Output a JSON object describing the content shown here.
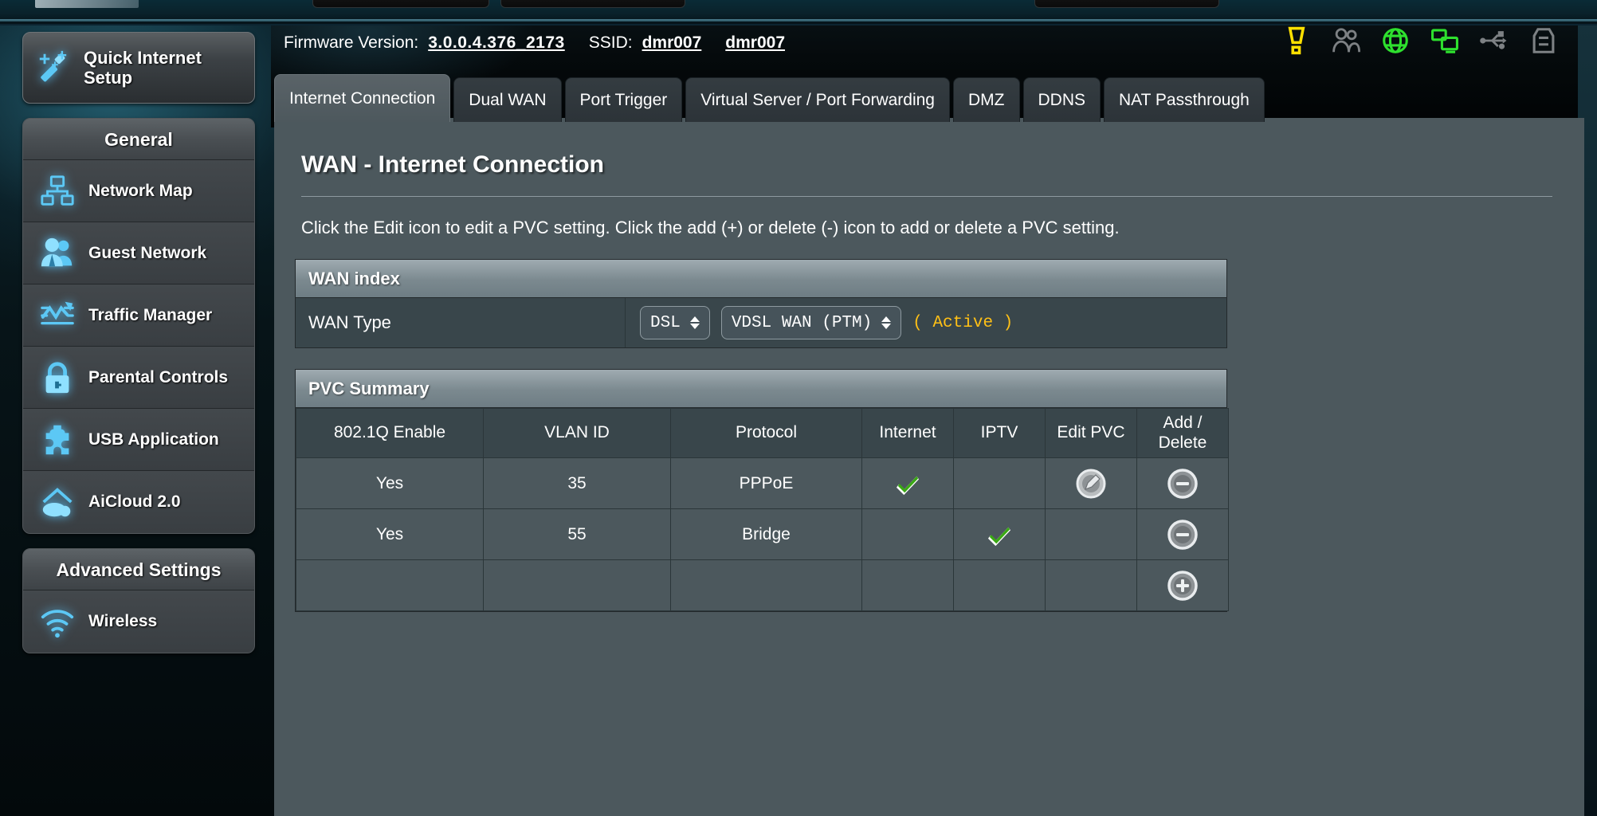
{
  "header": {
    "firmware_label": "Firmware Version:",
    "firmware_value": "3.0.0.4.376_2173",
    "ssid_label": "SSID:",
    "ssid_1": "dmr007",
    "ssid_2": "dmr007",
    "status_icons": [
      {
        "name": "alert-icon",
        "color": "#ffe000"
      },
      {
        "name": "guest-network-icon",
        "color": "#7d8184"
      },
      {
        "name": "internet-globe-icon",
        "color": "#2ee02e"
      },
      {
        "name": "clients-icon",
        "color": "#2ee02e"
      },
      {
        "name": "usb-icon",
        "color": "#7d8184"
      },
      {
        "name": "printer-icon",
        "color": "#7d8184"
      }
    ]
  },
  "sidebar": {
    "quick_setup": {
      "label": "Quick Internet Setup",
      "icon": "magic-wand-icon"
    },
    "general": {
      "title": "General",
      "items": [
        {
          "label": "Network Map",
          "icon": "network-map-icon"
        },
        {
          "label": "Guest Network",
          "icon": "guest-users-icon"
        },
        {
          "label": "Traffic Manager",
          "icon": "traffic-chart-icon"
        },
        {
          "label": "Parental Controls",
          "icon": "padlock-icon"
        },
        {
          "label": "USB Application",
          "icon": "puzzle-piece-icon"
        },
        {
          "label": "AiCloud 2.0",
          "icon": "cloud-house-icon"
        }
      ]
    },
    "advanced": {
      "title": "Advanced Settings",
      "items": [
        {
          "label": "Wireless",
          "icon": "wifi-icon"
        }
      ]
    }
  },
  "tabs": [
    {
      "label": "Internet Connection",
      "active": true
    },
    {
      "label": "Dual WAN",
      "active": false
    },
    {
      "label": "Port Trigger",
      "active": false
    },
    {
      "label": "Virtual Server / Port Forwarding",
      "active": false
    },
    {
      "label": "DMZ",
      "active": false
    },
    {
      "label": "DDNS",
      "active": false
    },
    {
      "label": "NAT Passthrough",
      "active": false
    }
  ],
  "main": {
    "title": "WAN - Internet Connection",
    "description": "Click the Edit icon to edit a PVC setting. Click the add (+) or delete (-) icon to add or delete a PVC setting.",
    "wan_index": {
      "section_title": "WAN index",
      "row_label": "WAN Type",
      "type_select": "DSL",
      "mode_select": "VDSL WAN (PTM)",
      "status": "( Active )",
      "status_color": "#ffc016"
    },
    "pvc_summary": {
      "section_title": "PVC Summary",
      "columns": [
        "802.1Q Enable",
        "VLAN ID",
        "Protocol",
        "Internet",
        "IPTV",
        "Edit PVC",
        "Add / Delete"
      ],
      "rows": [
        {
          "enable_8021q": "Yes",
          "vlan_id": "35",
          "protocol": "PPPoE",
          "internet": "check",
          "iptv": "",
          "edit_pvc": "edit",
          "add_delete": "delete"
        },
        {
          "enable_8021q": "Yes",
          "vlan_id": "55",
          "protocol": "Bridge",
          "internet": "",
          "iptv": "check",
          "edit_pvc": "",
          "add_delete": "delete"
        },
        {
          "enable_8021q": "",
          "vlan_id": "",
          "protocol": "",
          "internet": "",
          "iptv": "",
          "edit_pvc": "",
          "add_delete": "add"
        }
      ]
    }
  }
}
